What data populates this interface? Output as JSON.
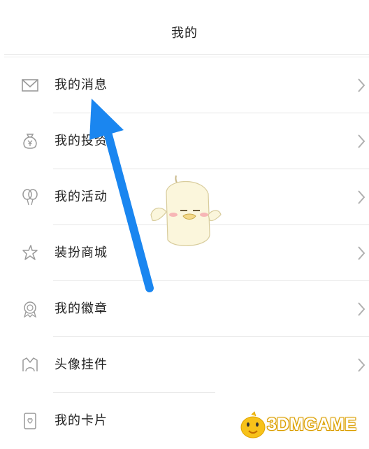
{
  "header": {
    "title": "我的"
  },
  "menu": [
    {
      "label": "我的消息",
      "icon": "mail-icon"
    },
    {
      "label": "我的投资",
      "icon": "money-bag-icon"
    },
    {
      "label": "我的活动",
      "icon": "balloon-icon"
    },
    {
      "label": "装扮商城",
      "icon": "star-icon"
    },
    {
      "label": "我的徽章",
      "icon": "badge-icon"
    },
    {
      "label": "头像挂件",
      "icon": "avatar-frame-icon"
    },
    {
      "label": "我的卡片",
      "icon": "card-icon"
    }
  ],
  "watermark": {
    "text": "3DMGAME"
  },
  "colors": {
    "arrow": "#1a86f0",
    "icon": "#999999",
    "chevron": "#b0b0b0",
    "watermark": "#f5b800"
  }
}
